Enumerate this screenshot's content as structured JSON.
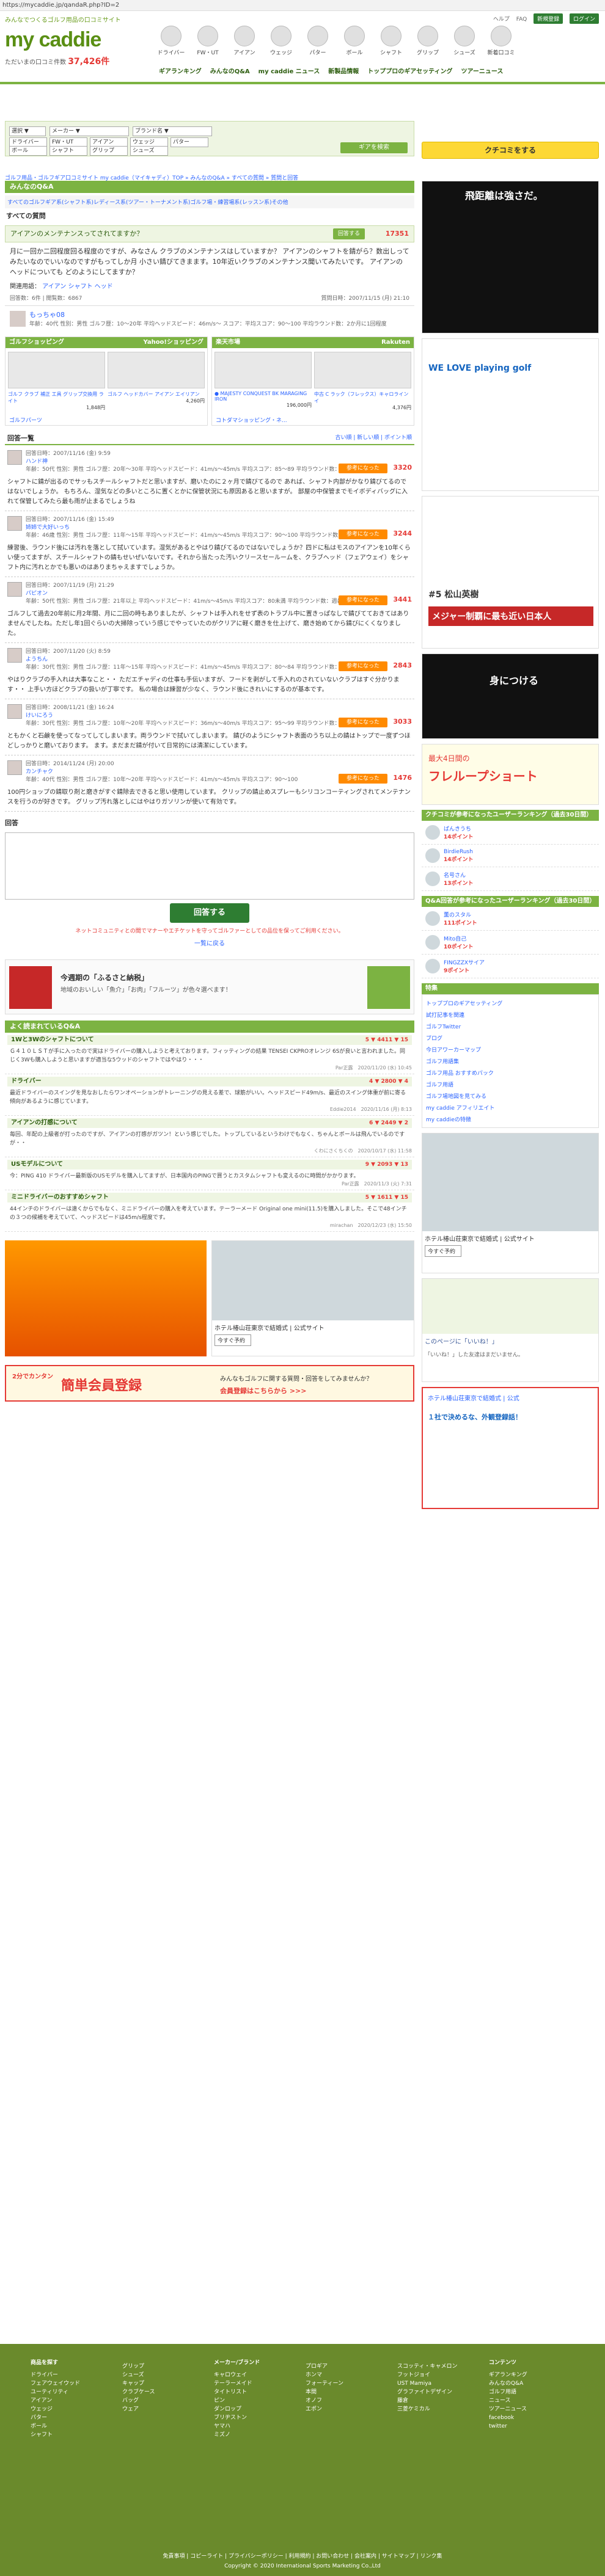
{
  "url": "https://mycaddie.jp/qandaR.php?ID=2",
  "header": {
    "tagline": "みんなでつくるゴルフ用品の口コミサイト",
    "logo": "my caddie",
    "count_label": "ただいまの口コミ件数",
    "count": "37,426件",
    "links": [
      "ヘルプ",
      "FAQ",
      "新規登録",
      "ログイン"
    ],
    "categories": [
      "ドライバー",
      "FW・UT",
      "アイアン",
      "ウェッジ",
      "パター",
      "ボール",
      "シャフト",
      "グリップ",
      "シューズ",
      "新着口コミ"
    ],
    "nav": [
      "ギアランキング",
      "みんなのQ&A",
      "my caddie ニュース",
      "新製品情報",
      "トッププロのギアセッティング",
      "ツアーニュース"
    ]
  },
  "search": {
    "fields": [
      "選択 ▼",
      "メーカー ▼",
      "ブランド名 ▼",
      "ドライバー",
      "FW・UT",
      "アイアン",
      "ウェッジ",
      "パター",
      "ボール",
      "シャフト",
      "グリップ",
      "シューズ"
    ],
    "button": "ギアを検索"
  },
  "kuchikomi_button": "クチコミをする",
  "breadcrumb": "ゴルフ用品・ゴルフギア口コミサイト my caddie（マイキャディ）TOP » みんなのQ&A » すべての質問 » 質問と回答",
  "qa": {
    "section_title": "みんなのQ&A",
    "tags": "すべてのゴルフギア系(シャフト系)レディース系(ツアー・トーナメント系)ゴルフ場・練習場系(レッスン系)その他",
    "all_label": "すべての質問",
    "question_title": "アイアンのメンテナンスってされてますか？",
    "answer_btn": "回答する",
    "likes": "17351",
    "body": "月に一回か二回程度回る程度のですが、みなさん クラブのメンテナンスはしていますか？ アイアンのシャフトを錆がら？数出しってみたいなのでいいなのですがもってしか月 小さい錆びてきまます。10年近いクラブのメンテナンス聞いてみたいです。 アイアンのヘッドについても どのようにしてますか？",
    "category_label": "関連用語：",
    "category_links": [
      "アイアン",
      "シャフト",
      "ヘッド"
    ],
    "answers_meta": "回答数：6件 | 閲覧数：6867",
    "date": "質問日時：2007/11/15 (月) 21:10",
    "asker": "もっちゃ08",
    "asker_meta": "年齢：40代 性別：男性 ゴルフ歴：10〜20年 平均ヘッドスピード：46m/s〜 スコア：平均スコア：90〜100 平均ラウンド数：2か月に1回程度"
  },
  "ads": {
    "left_title": "ゴルフショッピング",
    "left_brand": "Yahoo!ショッピング",
    "right_title": "楽天市場",
    "right_brand": "Rakuten",
    "left_items": [
      {
        "name": "ゴルフ クラブ 補正 工具 グリップ交換用 ライト",
        "price": "1,848円"
      },
      {
        "name": "ゴルフ ヘッドカバー アイアン エイリアン",
        "price": "4,260円"
      }
    ],
    "right_items": [
      {
        "name": "● MAJESTY CONQUEST BK MARAGING IRON",
        "price": "196,000円"
      },
      {
        "name": "中古 C ラック（フレックス）キャロラインイ",
        "price": "4,376円"
      }
    ],
    "left_link": "ゴルフパーツ",
    "right_link": "コトダマショッピング・ネ..."
  },
  "answers": {
    "header_left": "回答一覧",
    "header_right": "古い順 | 新しい順 | ポイント順",
    "help_label": "参考になった",
    "items": [
      {
        "user": "ハンド神",
        "date": "回答日時：2007/11/16 (金) 9:59",
        "meta": "年齢：50代 性別：男性 ゴルフ歴：20年〜30年 平均ヘッドスピード：41m/s〜45m/s 平均スコア：85〜89 平均ラウンド数：月に2回以上",
        "points": "3320",
        "body": "シャフトに錆が出るのでサッもスチールシャフトだと思いますが、磨いたのに２ヶ月で錆びてるので あれば、シャフト内部がかなり錆びてるのではないでしょうか。 もちろん、湿気などの多いところに置くとかに保管状況にも原因あると思いますが。 部屋の中保管までモイボディバッグに入れて保管してみたら最も雨が止まるでしょうね"
      },
      {
        "user": "姉姉で大好いっち",
        "date": "回答日時：2007/11/16 (金) 15:49",
        "meta": "年齢：46歳 性別：男性 ゴルフ歴：11年〜15年 平均ヘッドスピード：41m/s〜45m/s 平均スコア：90〜100 平均ラウンド数：月に1回程度",
        "points": "3244",
        "body": "練習後、ラウンド後には汚れを落として拭いています。湿気があるとやはり錆びてるのではないでしょうか？四ドに私はモスのアイアンを10年くらい使ってますが、スチールシャフトの錆もせいぜいないです。それから当たった汚いクリースセールームを、クラブヘッド（フェアウェイ）をシャフト内に汚れとかでも悪いのはありまちゃえますでしょうか。"
      },
      {
        "user": "パピオン",
        "date": "回答日時：2007/11/19 (月) 21:29",
        "meta": "年齢：50代 性別：男性 ゴルフ歴：21年以上 平均ヘッドスピード：41m/s〜45m/s 平均スコア：80未満 平均ラウンド数：週に1回程度",
        "points": "3441",
        "body": "ゴルフして過去20年前に月2年間、月に二回の時もありましたが、シャフトは手入れをせず表のトラブル中に置きっぱなしで錆びてておきてはありませんでしたね。ただし年1回ぐらいの大掃除っていう感じでやっていたのがクリアに軽く磨きを仕上げて、磨き始めてから錆びにくくなりました。"
      },
      {
        "user": "ようちん",
        "date": "回答日時：2007/11/20 (火) 8:59",
        "meta": "年齢：30代 性別：男性 ゴルフ歴：11年〜15年 平均ヘッドスピード：41m/s〜45m/s 平均スコア：80〜84 平均ラウンド数：月に2回以上",
        "points": "2843",
        "body": "やはりクラブの手入れは大事なこと・・ ただエチャディの仕事も手伝いますが、フードを剥がして手入れのされていないクラブはすぐ分かります・・ 上手い方ほどクラブの扱いが丁寧です。 私の場合は練習が少なく、ラウンド後にきれいにするのが基本です。"
      },
      {
        "user": "けいにろう",
        "date": "回答日時：2008/11/21 (金) 16:24",
        "meta": "年齢：30代 性別：男性 ゴルフ歴：10年〜20年 平均ヘッドスピード：36m/s〜40m/s 平均スコア：95〜99 平均ラウンド数：週に1回程度",
        "points": "3033",
        "body": "ともかくと石鹸を使ってなってしてしまいます。両ラウンドで拭いてしまいます。 錆びのようにシャフト表面のうち以上の錆はトップで一度ずつほどしっかりと磨いております。 ます。まだまだ錆が付いて日常的には清潔にしています。"
      },
      {
        "user": "カンチャク",
        "date": "回答日時：2014/11/24 (月) 20:00",
        "meta": "年齢：40代 性別：男性 ゴルフ歴：10年〜20年 平均ヘッドスピード：41m/s〜45m/s 平均スコア：90〜100",
        "points": "1476",
        "body": "100円ショップの錆取り剤と磨きがすぐ錆除去できると思い使用しています。 クリップの錆止めスプレーもシリコンコーティングされてメンテナンスを行うのが好きです。 グリップ汚れ落としにはやはりガソリンが使いて有効です。"
      }
    ]
  },
  "reply": {
    "label": "回答",
    "button": "回答する",
    "note": "ネットコミュニティとの間でマナーやエチケットを守ってゴルファーとしての品位を保ってご利用ください。",
    "back": "一覧に戻る"
  },
  "furusato": {
    "title": "今週期の「ふるさと納税」",
    "sub": "地域のおいしい「魚介」「お肉」「フルーツ」が色々選べます！"
  },
  "related": {
    "title": "よく読まれているQ&A",
    "items": [
      {
        "title": "1Wと3Wのシャフトについて",
        "stats": "5  ▼ 4411 ▼ 15",
        "body": "Ｇ４１０ＬＳＴが手に入ったので実はドライバーの購入しようと考えております。フィッティングの結果 TENSEI CKPROオレンジ 6Sが良いと言われました。同じく3Wも購入しようと思いますが適当な5ウッドのシャフトではやはり・・・",
        "by": "Par正露　2020/11/20 (水) 10:45"
      },
      {
        "title": "ドライバー",
        "stats": "4  ▼ 2800 ▼ 4",
        "body": "最近ドライバーのスイングを見なおしたらワンオペーションがトレーニングの見える差で、球筋がいい。ヘッドスピード49m/s、最近のスイング体重が前に寄る傾向があるように感じています。",
        "by": "Eddie2014　2020/11/16 (月) 8:13"
      },
      {
        "title": "アイアンの打感について",
        "stats": "6  ▼ 2449 ▼ 2",
        "body": "毎回、年配の上級者が打ったのですが、アイアンの打感がガツン！という感じでした。トップしているというわけでもなく、ちゃんとボールは飛んでいるのですが・・",
        "by": "くわにさくちくの　2020/10/17 (水) 11:58"
      },
      {
        "title": "USモデルについて",
        "stats": "9  ▼ 2093 ▼ 13",
        "body": "今：PING 410 ドライバー最新版のUSモデルを購入してますが、日本国内のPINGで買うとカスタムシャフトも変えるのに時間がかかります。",
        "by": "Par正露　2020/11/3 (火) 7:31"
      },
      {
        "title": "ミニドライバーのおすすめシャフト",
        "stats": "5  ▼ 1611 ▼ 15",
        "body": "44インチのドライバーは遠くからでもなく、ミニドライバーの購入を考えています。テーラーメード Original one mini(11.5)を購入しました。そこで48インチの３つの候補を考えていて、ヘッドスピードは45m/s程度です。",
        "by": "mirachan　2020/12/23 (水) 15:50"
      }
    ]
  },
  "signup": {
    "label": "2分でカンタン",
    "title": "簡単会員登録",
    "sub": "みんなもゴルフに関する質問・回答をしてみませんか？",
    "link": "会員登録はこちらから >>>"
  },
  "sidebar": {
    "ad1_text": "飛距離は強さだ。",
    "ad2_text": "WE LOVE playing golf",
    "ad3_title": "#5 松山英樹",
    "ad3_sub": "メジャー制覇に最も近い日本人",
    "ad4_text": "身につける",
    "ad5_title": "最大4日間の",
    "ad5_sub": "フレループショート",
    "rank1_title": "クチコミが参考になったユーザーランキング（過去30日間）",
    "rank1": [
      {
        "name": "ばんきうち",
        "pts": "14ポイント"
      },
      {
        "name": "BirdieRush",
        "pts": "14ポイント"
      },
      {
        "name": "名号さん",
        "pts": "13ポイント"
      }
    ],
    "rank2_title": "Q&A回答が参考になったユーザーランキング（過去30日間）",
    "rank2": [
      {
        "name": "薫のスタル",
        "pts": "111ポイント"
      },
      {
        "name": "Mito自己",
        "pts": "10ポイント"
      },
      {
        "name": "FINGZZXサイア",
        "pts": "9ポイント"
      }
    ],
    "menu_title": "特集",
    "menu": [
      "トッププロのギアセッティング",
      "試打記事を関連",
      "ゴルフTwitter",
      "ブログ",
      "今日アワーカーマップ",
      "ゴルフ用語集",
      "ゴルフ用品 おすすめパック",
      "ゴルフ用語",
      "ゴルフ場地図を見てみる",
      "my caddie アフィリエイト",
      "my caddieの特徴"
    ],
    "hotel1": "ホテル椿山荘東京で結婚式 | 公式サイト",
    "hotel_btn": "今すぐ予約",
    "fb_like": "このページに「いいね！」",
    "fb_count": "「いいね！」した友達はまだいません。",
    "sponsored": "ホテル椿山荘東京で結婚式 | 公式",
    "sponsored_btn": "１社で決めるな、外観登録話！"
  },
  "footer": {
    "cols": [
      {
        "title": "商品を探す",
        "items": [
          "ドライバー",
          "フェアウェイウッド",
          "ユーティリティ",
          "アイアン",
          "ウェッジ",
          "パター",
          "ボール",
          "シャフト"
        ]
      },
      {
        "title": "",
        "items": [
          "グリップ",
          "シューズ",
          "キャップ",
          "クラブケース",
          "バッグ",
          "ウェア"
        ]
      },
      {
        "title": "メーカー/ブランド",
        "items": [
          "キャロウェイ",
          "テーラーメイド",
          "タイトリスト",
          "ピン",
          "ダンロップ",
          "ブリヂストン",
          "ヤマハ",
          "ミズノ"
        ]
      },
      {
        "title": "",
        "items": [
          "プロギア",
          "ホンマ",
          "フォーティーン",
          "本間",
          "オノフ",
          "エポン"
        ]
      },
      {
        "title": "",
        "items": [
          "スコッティ・キャメロン",
          "フットジョイ",
          "UST Mamiya",
          "グラファイトデザイン",
          "藤倉",
          "三菱ケミカル"
        ]
      },
      {
        "title": "コンテンツ",
        "items": [
          "ギアランキング",
          "みんなのQ&A",
          "ゴルフ用語",
          "ニュース",
          "ツアーニュース",
          "facebook",
          "twitter"
        ]
      }
    ],
    "links": "免責事項 | コピーライト | プライバシーポリシー | 利用規約 | お問い合わせ | 会社案内 | サイトマップ | リンク集",
    "copyright": "Copyright © 2020 International Sports Marketing Co.,Ltd"
  }
}
